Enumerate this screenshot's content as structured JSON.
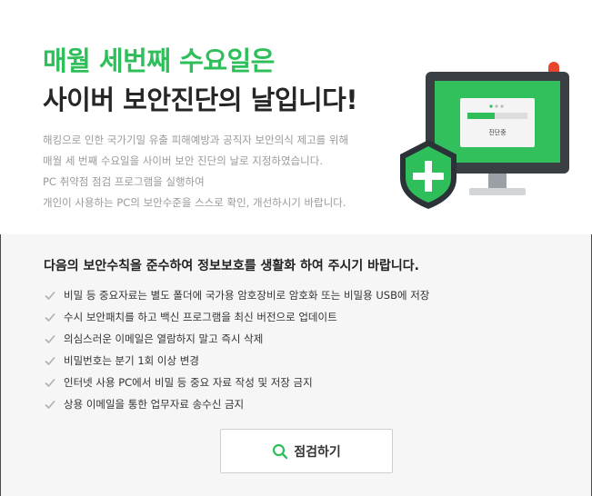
{
  "hero": {
    "headline_green": "매월 세번째 수요일은",
    "headline_dark": "사이버 보안진단의 날입니다!",
    "description": [
      "해킹으로 인한 국가기밀 유출 피해예방과 공직자 보안의식 제고를 위해",
      "매월 세 번째 수요일을 사이버 보안 진단의 날로 지정하였습니다.",
      "PC 취약점 점검 프로그램을 실행하여",
      "개인이 사용하는 PC의 보안수준을 스스로 확인, 개선하시기 바랍니다."
    ],
    "illustration": {
      "screen_label": "진단중",
      "shield_icon": "plus-shield-icon"
    }
  },
  "notice": {
    "title": "다음의 보안수칙을 준수하여 정보보호를 생활화 하여 주시기 바랍니다.",
    "rules": [
      "비밀 등 중요자료는 별도 폴더에 국가용 암호장비로 암호화 또는 비밀용 USB에 저장",
      "수시 보안패치를 하고 백신 프로그램을 최신 버전으로 업데이트",
      "의심스러운 이메일은 열람하지 말고 즉시 삭제",
      "비밀번호는 분기 1회 이상 변경",
      "인터넷 사용 PC에서 비밀 등 중요 자료 작성 및 저장 금지",
      "상용 이메일을 통한 업무자료 송수신 금지"
    ]
  },
  "action": {
    "check_button_label": "점검하기",
    "check_button_icon": "search-icon"
  },
  "colors": {
    "accent_green": "#2fbf5a",
    "monitor_dark": "#3a3f44",
    "panel_bg": "#f6f6f6"
  }
}
